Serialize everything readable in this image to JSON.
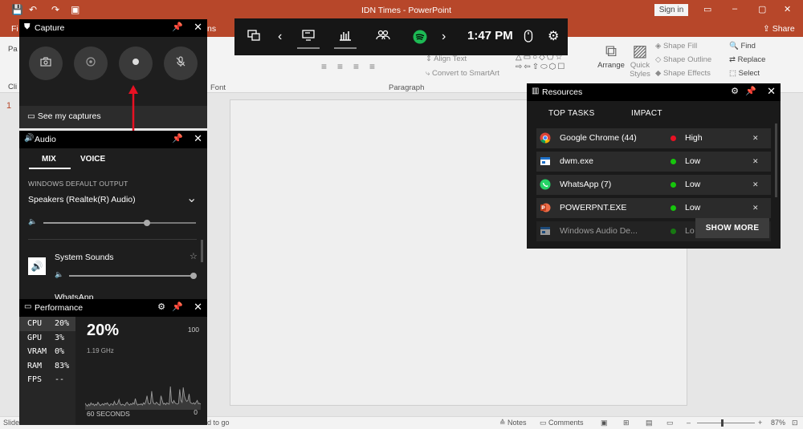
{
  "ppt": {
    "title": "IDN Times  -  PowerPoint",
    "signin": "Sign in",
    "tab_file": "Fi",
    "tab_ns": "ns",
    "share": "Share",
    "group_font": "Font",
    "group_paragraph": "Paragraph",
    "group_clip": "Cli",
    "group_pa": "Pa",
    "align_text": "Align Text",
    "convert_smartart": "Convert to SmartArt",
    "arrange": "Arrange",
    "quick_styles_1": "Quick",
    "quick_styles_2": "Styles",
    "shape_fill": "Shape Fill",
    "shape_outline": "Shape Outline",
    "shape_effects": "Shape Effects",
    "find": "Find",
    "replace": "Replace",
    "select": "Select",
    "slide_number": "1",
    "status_left": "Slide",
    "status_mid": "d to go",
    "notes": "Notes",
    "comments": "Comments",
    "zoom": "87%"
  },
  "gamebar": {
    "time": "1:47 PM"
  },
  "capture": {
    "title": "Capture",
    "see_captures": "See my captures"
  },
  "audio": {
    "title": "Audio",
    "tabs": [
      "MIX",
      "VOICE"
    ],
    "section_label": "WINDOWS DEFAULT OUTPUT",
    "device": "Speakers (Realtek(R) Audio)",
    "master_level": 0.68,
    "app1": "System Sounds",
    "app1_level": 1.0,
    "app2": "WhatsApp"
  },
  "performance": {
    "title": "Performance",
    "metrics": [
      {
        "name": "CPU",
        "value": "20%"
      },
      {
        "name": "GPU",
        "value": "3%"
      },
      {
        "name": "VRAM",
        "value": "0%"
      },
      {
        "name": "RAM",
        "value": "83%"
      },
      {
        "name": "FPS",
        "value": "--"
      }
    ],
    "big_value": "20%",
    "freq": "1.19 GHz",
    "max_label": "100",
    "min_label": "0",
    "span_label": "60 SECONDS"
  },
  "chart_data": {
    "type": "area",
    "ylim": [
      0,
      100
    ],
    "values": [
      14,
      10,
      8,
      12,
      9,
      15,
      11,
      13,
      9,
      12,
      10,
      16,
      12,
      9,
      11,
      13,
      10,
      14,
      12,
      15,
      11,
      9,
      13,
      12,
      10,
      18,
      12,
      11,
      14,
      22,
      13,
      10,
      12,
      11,
      9,
      14,
      16,
      12,
      10,
      13,
      11,
      15,
      12,
      24,
      14,
      10,
      12,
      11,
      13,
      10,
      15,
      12,
      18,
      30,
      15,
      12,
      14,
      40,
      18,
      13,
      12,
      16,
      14,
      11,
      10,
      30,
      20,
      12,
      14,
      11,
      15,
      13,
      12,
      50,
      18,
      14,
      20,
      15,
      13,
      12,
      14,
      44,
      20,
      16,
      48,
      30,
      22,
      18,
      20,
      34,
      16,
      14,
      13,
      15,
      12,
      16,
      20,
      13,
      14,
      12
    ]
  },
  "resources": {
    "title": "Resources",
    "col_task": "TOP TASKS",
    "col_impact": "IMPACT",
    "rows": [
      {
        "name": "Google Chrome (44)",
        "impact": "High",
        "status_color": "#e81123"
      },
      {
        "name": "dwm.exe",
        "impact": "Low",
        "status_color": "#16c60c"
      },
      {
        "name": "WhatsApp (7)",
        "impact": "Low",
        "status_color": "#16c60c"
      },
      {
        "name": "POWERPNT.EXE",
        "impact": "Low",
        "status_color": "#16c60c"
      },
      {
        "name": "Windows Audio De...",
        "impact": "Lo",
        "status_color": "#16c60c"
      }
    ],
    "show_more": "SHOW MORE"
  },
  "colors": {
    "ppt_red": "#b7472a",
    "panel_bg": "#1a1a1a",
    "arrow": "#e81123"
  }
}
